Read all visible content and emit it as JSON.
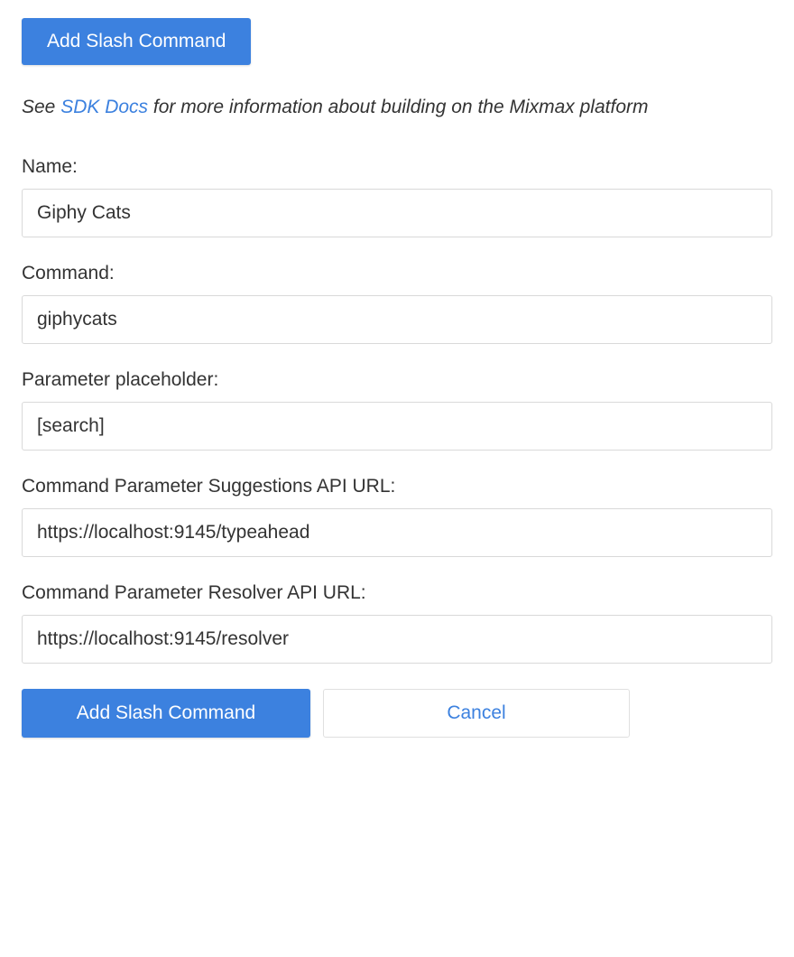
{
  "header": {
    "add_button_label": "Add Slash Command"
  },
  "info": {
    "prefix": "See ",
    "link_text": "SDK Docs",
    "suffix": " for more information about building on the Mixmax platform"
  },
  "form": {
    "name": {
      "label": "Name:",
      "value": "Giphy Cats"
    },
    "command": {
      "label": "Command:",
      "value": "giphycats"
    },
    "param_placeholder": {
      "label": "Parameter placeholder:",
      "value": "[search]"
    },
    "suggestions_url": {
      "label": "Command Parameter Suggestions API URL:",
      "value": "https://localhost:9145/typeahead"
    },
    "resolver_url": {
      "label": "Command Parameter Resolver API URL:",
      "value": "https://localhost:9145/resolver"
    }
  },
  "footer": {
    "submit_label": "Add Slash Command",
    "cancel_label": "Cancel"
  }
}
